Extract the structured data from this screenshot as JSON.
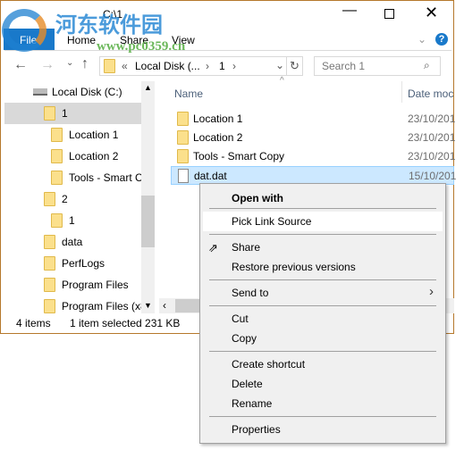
{
  "window": {
    "title": "C:\\1",
    "tabs": [
      "File",
      "Home",
      "Share",
      "View"
    ]
  },
  "address": {
    "path": [
      "«",
      "Local Disk (...",
      "›",
      "1",
      "›"
    ],
    "search_placeholder": "Search 1"
  },
  "nav": {
    "items": [
      {
        "label": "Local Disk (C:)",
        "icon": "drive-icon"
      },
      {
        "label": "1",
        "icon": "folder-icon",
        "selected": true
      },
      {
        "label": "Location 1",
        "icon": "folder-icon"
      },
      {
        "label": "Location 2",
        "icon": "folder-icon"
      },
      {
        "label": "Tools - Smart Co",
        "icon": "folder-icon"
      },
      {
        "label": "2",
        "icon": "folder-icon"
      },
      {
        "label": "1",
        "icon": "folder-link-icon"
      },
      {
        "label": "data",
        "icon": "folder-icon"
      },
      {
        "label": "PerfLogs",
        "icon": "folder-icon"
      },
      {
        "label": "Program Files",
        "icon": "folder-icon"
      },
      {
        "label": "Program Files (x8",
        "icon": "folder-icon"
      }
    ]
  },
  "content": {
    "columns": [
      "Name",
      "Date moc"
    ],
    "rows": [
      {
        "name": "Location 1",
        "date": "23/10/201",
        "type": "folder"
      },
      {
        "name": "Location 2",
        "date": "23/10/201",
        "type": "folder"
      },
      {
        "name": "Tools - Smart Copy",
        "date": "23/10/201",
        "type": "folder"
      },
      {
        "name": "dat.dat",
        "date": "15/10/201",
        "type": "file",
        "selected": true
      }
    ]
  },
  "status": {
    "count": "4 items",
    "selection": "1 item selected  231 KB"
  },
  "context_menu": {
    "items": {
      "open_with": "Open with",
      "pick_link": "Pick Link Source",
      "share": "Share",
      "restore": "Restore previous versions",
      "send_to": "Send to",
      "cut": "Cut",
      "copy": "Copy",
      "create_shortcut": "Create shortcut",
      "delete": "Delete",
      "rename": "Rename",
      "properties": "Properties"
    }
  },
  "watermark": {
    "name": "河东软件园",
    "url": "www.pc0359.cn"
  },
  "colors": {
    "accent": "#1979ca",
    "selection": "#cce8ff",
    "window_border": "#b5782c"
  }
}
